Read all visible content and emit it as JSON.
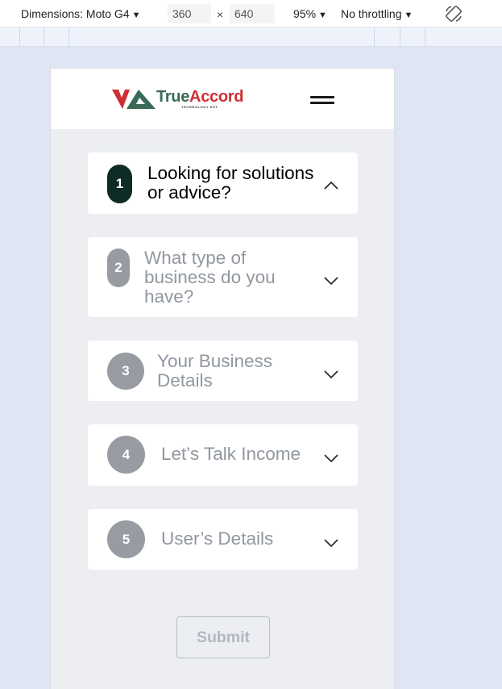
{
  "devtools": {
    "device_label": "Dimensions: Moto G4",
    "width": "360",
    "times": "×",
    "height": "640",
    "zoom": "95%",
    "throttling": "No throttling"
  },
  "header": {
    "logo_part1": "True",
    "logo_part2": "Accord",
    "logo_subtitle": "TECHNOLOGY EST"
  },
  "steps": [
    {
      "number": "1",
      "title_lines": [
        "Looking for solutions",
        "or advice?"
      ],
      "state": "active"
    },
    {
      "number": "2",
      "title_lines": [
        "What type of",
        "business do you",
        "have?"
      ],
      "state": "inactive"
    },
    {
      "number": "3",
      "title_lines": [
        "Your Business",
        "Details"
      ],
      "state": "inactive"
    },
    {
      "number": "4",
      "title_lines": [
        "Let’s Talk Income"
      ],
      "state": "inactive"
    },
    {
      "number": "5",
      "title_lines": [
        "User’s Details"
      ],
      "state": "inactive"
    }
  ],
  "submit_label": "Submit",
  "colors": {
    "brand_green": "#3a6b57",
    "brand_red": "#cf2e34",
    "active_badge": "#0e2b27",
    "inactive_badge": "#979ca3",
    "inactive_text": "#9197a0"
  }
}
